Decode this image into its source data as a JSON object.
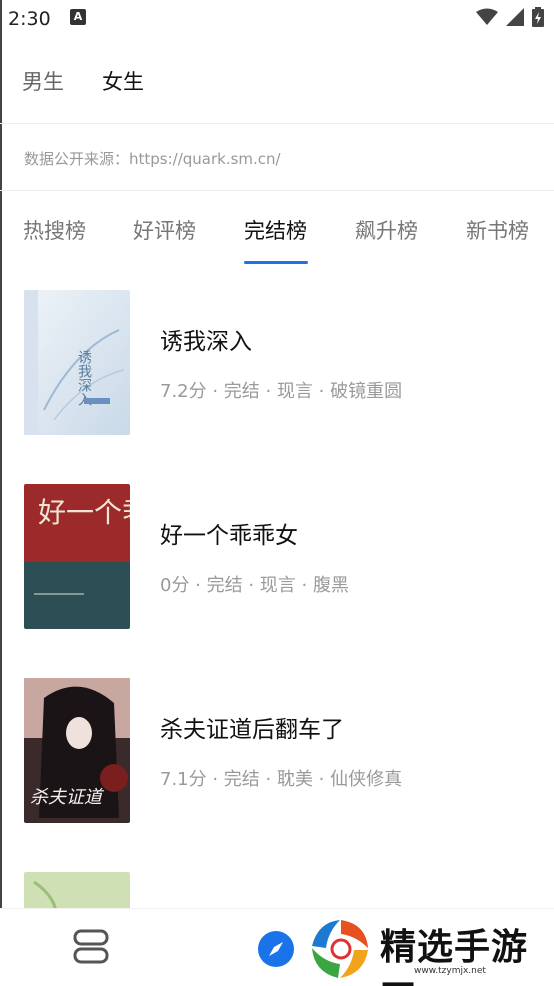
{
  "status_bar": {
    "time": "2:30",
    "notification_glyph": "A"
  },
  "gender_tabs": [
    {
      "label": "男生",
      "selected": false
    },
    {
      "label": "女生",
      "selected": true
    }
  ],
  "source_note": "数据公开来源：https://quark.sm.cn/",
  "rank_tabs": [
    {
      "label": "热搜榜",
      "selected": false
    },
    {
      "label": "好评榜",
      "selected": false
    },
    {
      "label": "完结榜",
      "selected": true
    },
    {
      "label": "飙升榜",
      "selected": false
    },
    {
      "label": "新书榜",
      "selected": false
    }
  ],
  "books": [
    {
      "title": "诱我深入",
      "meta": "7.2分 · 完结 · 现言 · 破镜重圆",
      "cover_text": "诱我深入"
    },
    {
      "title": "好一个乖乖女",
      "meta": "0分 · 完结 · 现言 · 腹黑",
      "cover_text": "好一个乖乖女"
    },
    {
      "title": "杀夫证道后翻车了",
      "meta": "7.1分 · 完结 · 耽美 · 仙侠修真",
      "cover_text": "杀夫证道"
    },
    {
      "title": "",
      "meta": "",
      "cover_text": ""
    }
  ],
  "bottom_nav": {
    "shelf_icon": "bookshelf-icon",
    "discover_icon": "compass-icon"
  },
  "watermark": {
    "text": "精选手游网",
    "url": "www.tzymjx.net"
  },
  "colors": {
    "accent": "#1a73e8",
    "meta_gray": "#9a9a9a"
  }
}
